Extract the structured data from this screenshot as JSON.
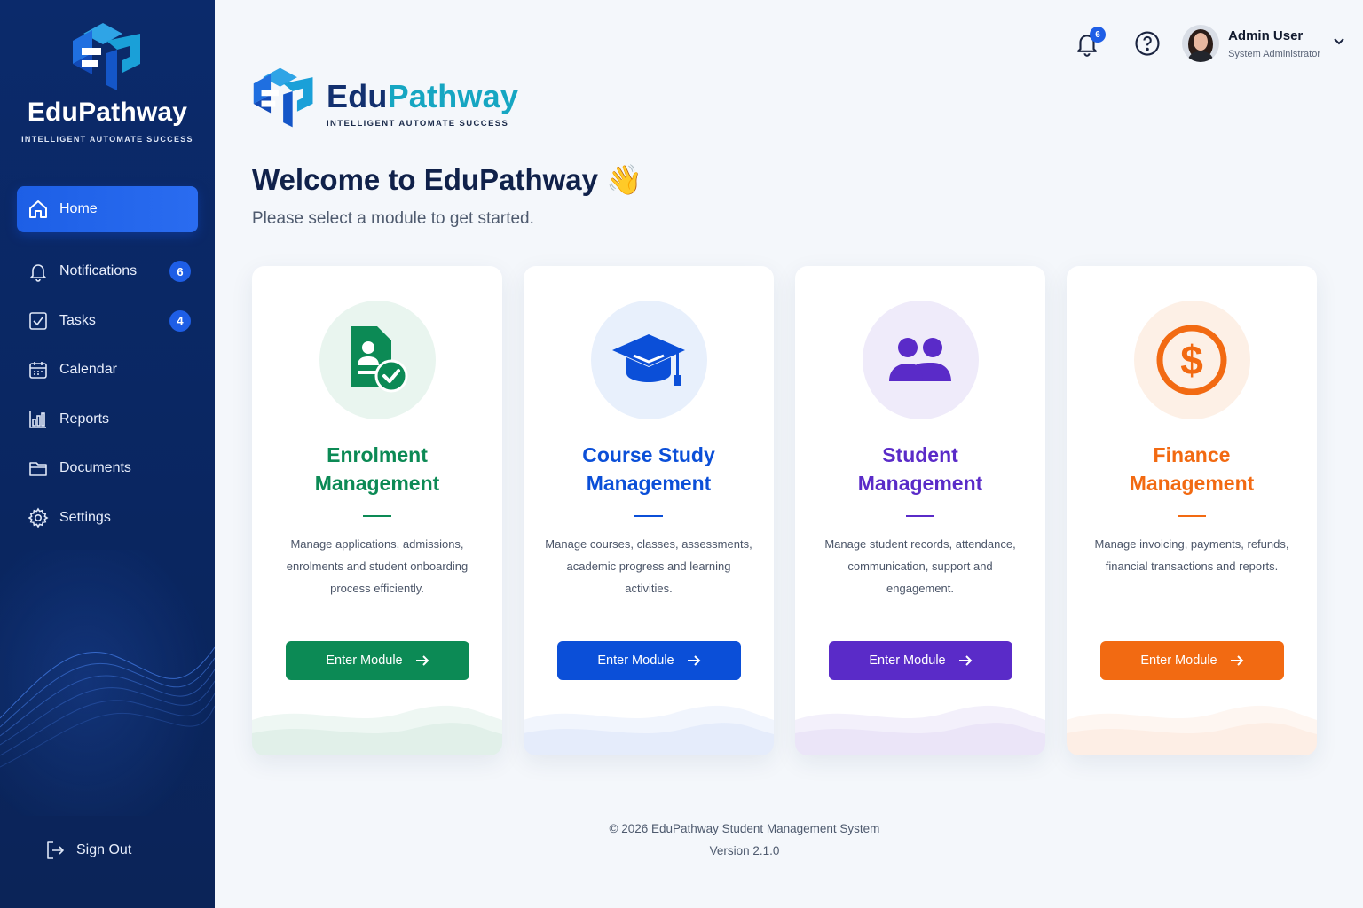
{
  "brand": {
    "name_part1": "Edu",
    "name_part2": "Pathway",
    "sidebar_name": "EduPathway",
    "tagline": "INTELLIGENT AUTOMATE SUCCESS"
  },
  "sidebar": {
    "items": [
      {
        "label": "Home",
        "icon": "home-icon",
        "active": true
      },
      {
        "label": "Notifications",
        "icon": "bell-icon",
        "badge": "6"
      },
      {
        "label": "Tasks",
        "icon": "checkbox-icon",
        "badge": "4"
      },
      {
        "label": "Calendar",
        "icon": "calendar-icon"
      },
      {
        "label": "Reports",
        "icon": "bar-chart-icon"
      },
      {
        "label": "Documents",
        "icon": "folder-icon"
      },
      {
        "label": "Settings",
        "icon": "gear-icon"
      }
    ],
    "signout": {
      "label": "Sign Out",
      "icon": "sign-out-icon"
    }
  },
  "topbar": {
    "notification_count": "6",
    "user_name": "Admin User",
    "user_role": "System Administrator"
  },
  "header": {
    "welcome": "Welcome to EduPathway 👋",
    "subtitle": "Please select a module to get started."
  },
  "modules": [
    {
      "title_line1": "Enrolment",
      "title_line2": "Management",
      "description": "Manage applications, admissions, enrolments and student onboarding process efficiently.",
      "button": "Enter Module",
      "color": "#0c8a55",
      "icon": "document-check-icon"
    },
    {
      "title_line1": "Course Study",
      "title_line2": "Management",
      "description": "Manage courses, classes, assessments, academic progress and learning activities.",
      "button": "Enter Module",
      "color": "#0b4fd8",
      "icon": "graduation-cap-icon"
    },
    {
      "title_line1": "Student",
      "title_line2": "Management",
      "description": "Manage student records, attendance, communication, support and engagement.",
      "button": "Enter Module",
      "color": "#5a2bc8",
      "icon": "users-icon"
    },
    {
      "title_line1": "Finance",
      "title_line2": "Management",
      "description": "Manage invoicing, payments, refunds, financial transactions and reports.",
      "button": "Enter Module",
      "color": "#f26a12",
      "icon": "dollar-icon"
    }
  ],
  "footer": {
    "copyright": "© 2026 EduPathway Student Management System",
    "version": "Version 2.1.0"
  }
}
